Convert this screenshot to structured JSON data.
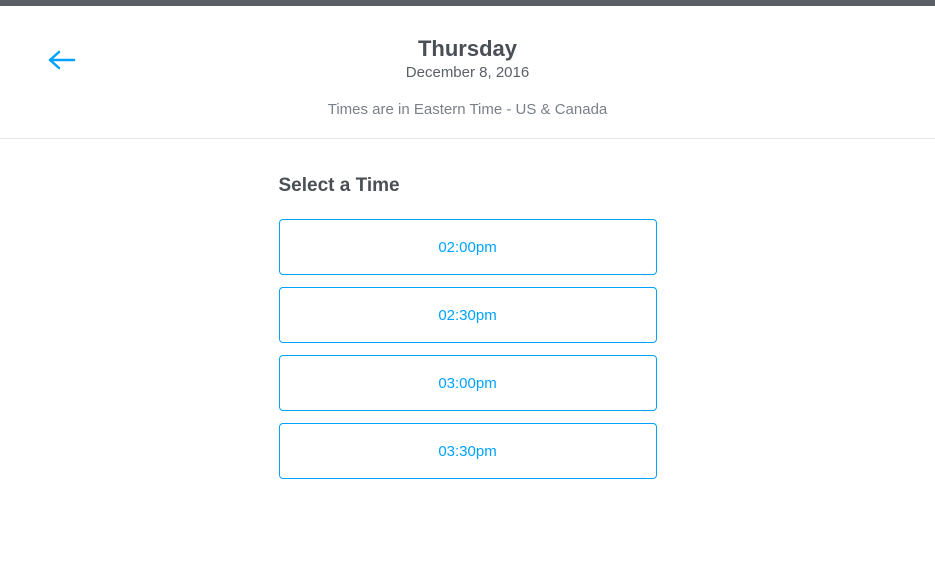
{
  "header": {
    "day_name": "Thursday",
    "date": "December 8, 2016",
    "timezone_note": "Times are in Eastern Time - US & Canada"
  },
  "content": {
    "select_title": "Select a Time",
    "time_slots": [
      "02:00pm",
      "02:30pm",
      "03:00pm",
      "03:30pm"
    ]
  },
  "colors": {
    "accent": "#00a2ff",
    "text_dark": "#4a4f55",
    "text_muted": "#7a8088"
  }
}
